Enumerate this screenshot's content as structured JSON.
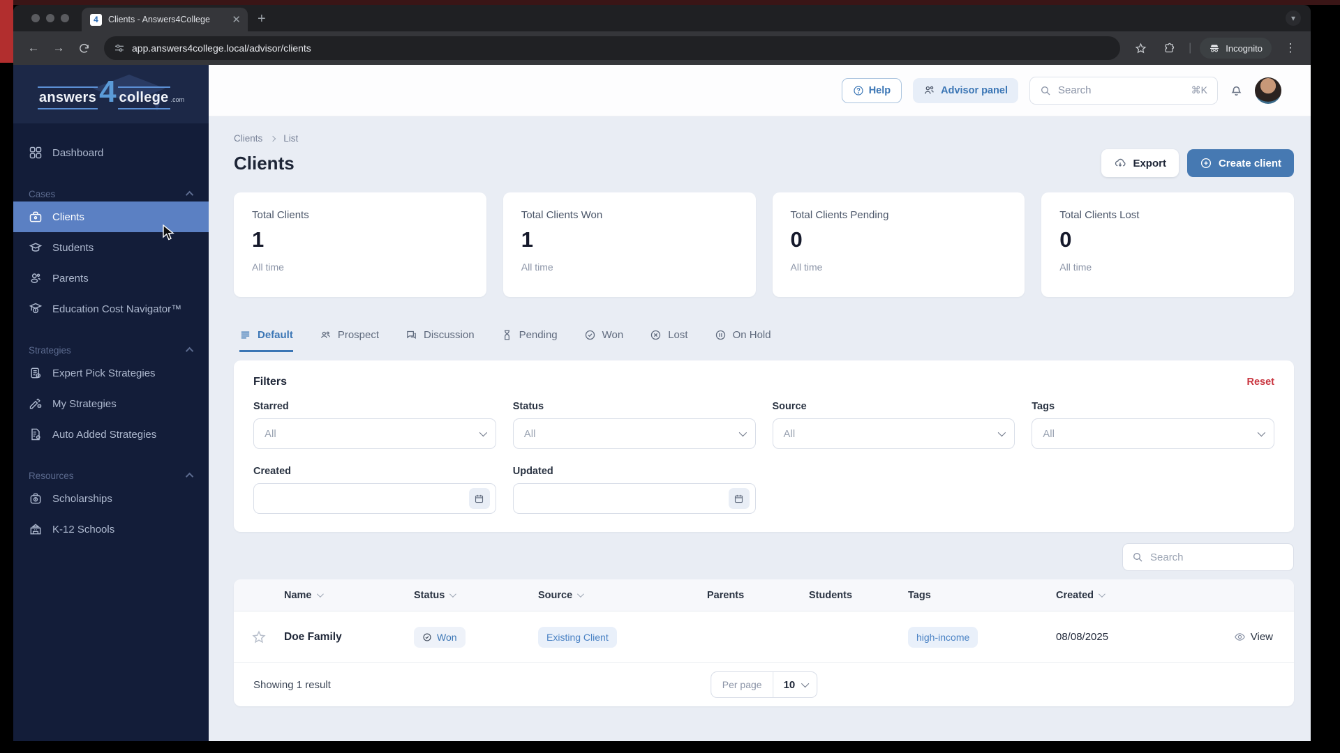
{
  "browser": {
    "tab_title": "Clients - Answers4College",
    "url": "app.answers4college.local/advisor/clients",
    "incognito": "Incognito"
  },
  "sidebar": {
    "logo_answers": "answers",
    "logo_4": "4",
    "logo_college": "college",
    "logo_tld": ".com",
    "dashboard": "Dashboard",
    "sections": [
      {
        "label": "Cases",
        "items": [
          {
            "label": "Clients"
          },
          {
            "label": "Students"
          },
          {
            "label": "Parents"
          },
          {
            "label": "Education Cost Navigator™"
          }
        ]
      },
      {
        "label": "Strategies",
        "items": [
          {
            "label": "Expert Pick Strategies"
          },
          {
            "label": "My Strategies"
          },
          {
            "label": "Auto Added Strategies"
          }
        ]
      },
      {
        "label": "Resources",
        "items": [
          {
            "label": "Scholarships"
          },
          {
            "label": "K-12 Schools"
          }
        ]
      }
    ]
  },
  "header": {
    "help": "Help",
    "advisor_panel": "Advisor panel",
    "search_placeholder": "Search",
    "shortcut": "⌘K"
  },
  "page": {
    "breadcrumb_1": "Clients",
    "breadcrumb_2": "List",
    "title": "Clients",
    "export_label": "Export",
    "create_label": "Create client"
  },
  "stats": [
    {
      "label": "Total Clients",
      "value": "1",
      "period": "All time"
    },
    {
      "label": "Total Clients Won",
      "value": "1",
      "period": "All time"
    },
    {
      "label": "Total Clients Pending",
      "value": "0",
      "period": "All time"
    },
    {
      "label": "Total Clients Lost",
      "value": "0",
      "period": "All time"
    }
  ],
  "tabs": [
    {
      "label": "Default"
    },
    {
      "label": "Prospect"
    },
    {
      "label": "Discussion"
    },
    {
      "label": "Pending"
    },
    {
      "label": "Won"
    },
    {
      "label": "Lost"
    },
    {
      "label": "On Hold"
    }
  ],
  "filters": {
    "title": "Filters",
    "reset": "Reset",
    "selects": [
      {
        "label": "Starred",
        "value": "All"
      },
      {
        "label": "Status",
        "value": "All"
      },
      {
        "label": "Source",
        "value": "All"
      },
      {
        "label": "Tags",
        "value": "All"
      }
    ],
    "dates": [
      {
        "label": "Created"
      },
      {
        "label": "Updated"
      }
    ]
  },
  "list": {
    "search_placeholder": "Search",
    "columns": {
      "name": "Name",
      "status": "Status",
      "source": "Source",
      "parents": "Parents",
      "students": "Students",
      "tags": "Tags",
      "created": "Created"
    },
    "row": {
      "name": "Doe Family",
      "status": "Won",
      "source": "Existing Client",
      "tag": "high-income",
      "created": "08/08/2025",
      "view": "View"
    },
    "footer": {
      "summary": "Showing 1 result",
      "per_page_label": "Per page",
      "per_page_value": "10"
    }
  },
  "colors": {
    "accent": "#4679b2",
    "sidebar_active": "#5b80c3",
    "reset_red": "#c9353f"
  }
}
